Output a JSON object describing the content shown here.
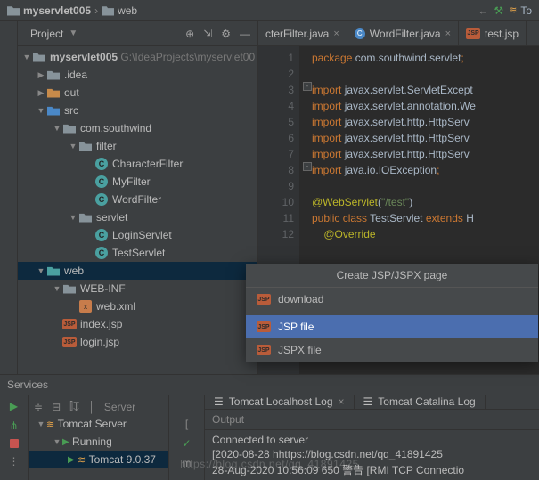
{
  "breadcrumb": {
    "project": "myservlet005",
    "folder": "web"
  },
  "top_right": {
    "tomcat_label": "To"
  },
  "project_panel": {
    "title": "Project",
    "root": "myservlet005",
    "root_path": "G:\\IdeaProjects\\myservlet00",
    "nodes": {
      "idea": ".idea",
      "out": "out",
      "src": "src",
      "package": "com.southwind",
      "filter": "filter",
      "character_filter": "CharacterFilter",
      "my_filter": "MyFilter",
      "word_filter": "WordFilter",
      "servlet": "servlet",
      "login_servlet": "LoginServlet",
      "test_servlet": "TestServlet",
      "web": "web",
      "web_inf": "WEB-INF",
      "web_xml": "web.xml",
      "index_jsp": "index.jsp",
      "login_jsp": "login.jsp"
    }
  },
  "tabs": {
    "t1": "cterFilter.java",
    "t2": "WordFilter.java",
    "t3": "test.jsp"
  },
  "code_lines": {
    "l1": "1",
    "l2": "2",
    "l3": "3",
    "l4": "4",
    "l5": "5",
    "l6": "6",
    "l7": "7",
    "l8": "8",
    "l9": "9",
    "l10": "10",
    "l11": "11",
    "l12": "12"
  },
  "code": {
    "pkg_kw": "package ",
    "pkg_name": "com.southwind.servlet",
    "semi": ";",
    "import_kw": "import ",
    "imp1": "javax.servlet.ServletExcept",
    "imp2": "javax.servlet.annotation.We",
    "imp3": "javax.servlet.http.HttpServ",
    "imp4": "javax.servlet.http.HttpServ",
    "imp5": "javax.servlet.http.HttpServ",
    "imp6": "java.io.IOException",
    "ann_name": "@WebServlet",
    "ann_arg": "\"/test\"",
    "public": "public ",
    "class": "class ",
    "class_name": "TestServlet ",
    "extends": "extends ",
    "extends_name": "H",
    "override": "@Override"
  },
  "popup": {
    "title": "Create JSP/JSPX page",
    "download": "download",
    "jsp_file": "JSP file",
    "jspx_file": "JSPX file"
  },
  "services": {
    "label": "Services",
    "tool_server": "Server",
    "tab_localhost": "Tomcat Localhost Log",
    "tab_catalina": "Tomcat Catalina Log",
    "tree_server": "Tomcat Server",
    "tree_running": "Running",
    "tree_instance": "Tomcat 9.0.37",
    "mid_open": "[",
    "mid_check": "✓",
    "mid_m": "m",
    "output_label": "Output",
    "console": {
      "c1": "Connected to server",
      "c2": "[2020-08-28 hhttps://blog.csdn.net/qq_41891425",
      "c3": "28-Aug-2020 10:56:09 650 警告 [RMI TCP Connectio"
    }
  }
}
